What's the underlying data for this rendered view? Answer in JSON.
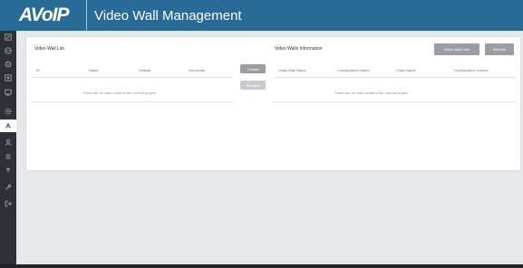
{
  "header": {
    "logo": "AVoIP",
    "title": "Video Wall Management"
  },
  "sidebar": {
    "items": [
      {
        "icon": "edit-icon",
        "active": false
      },
      {
        "icon": "globe-icon",
        "active": false
      },
      {
        "icon": "settings-icon",
        "active": false
      },
      {
        "icon": "grid-icon",
        "active": false
      },
      {
        "icon": "monitor-icon",
        "active": false
      },
      {
        "icon": "gear-icon",
        "active": false
      },
      {
        "icon": "video-wall-icon",
        "active": true
      },
      {
        "icon": "user-icon",
        "active": false
      },
      {
        "icon": "list-icon",
        "active": false
      },
      {
        "icon": "upload-icon",
        "active": false
      },
      {
        "icon": "wrench-icon",
        "active": false
      },
      {
        "icon": "logout-icon",
        "active": false
      }
    ]
  },
  "video_wall_list": {
    "title": "Video Wall List",
    "columns": [
      "ID",
      "Name",
      "Vertical",
      "Horizontal"
    ],
    "empty_message": "There are no video walls in the current project."
  },
  "actions": {
    "create_label": "Create",
    "remove_label": "Remove"
  },
  "video_walls_information": {
    "title": "Video Walls Information",
    "help_label": "Video Wall Help",
    "refresh_label": "Refresh",
    "columns": [
      "Video Wall Name",
      "Configuration Name",
      "Class Name",
      "Configuration Source"
    ],
    "empty_message": "There are no video walls in the current project."
  },
  "colors": {
    "header": "#276b96",
    "sidebar": "#2c3136",
    "button": "#9a9ea2",
    "background": "#e6e7e9"
  }
}
